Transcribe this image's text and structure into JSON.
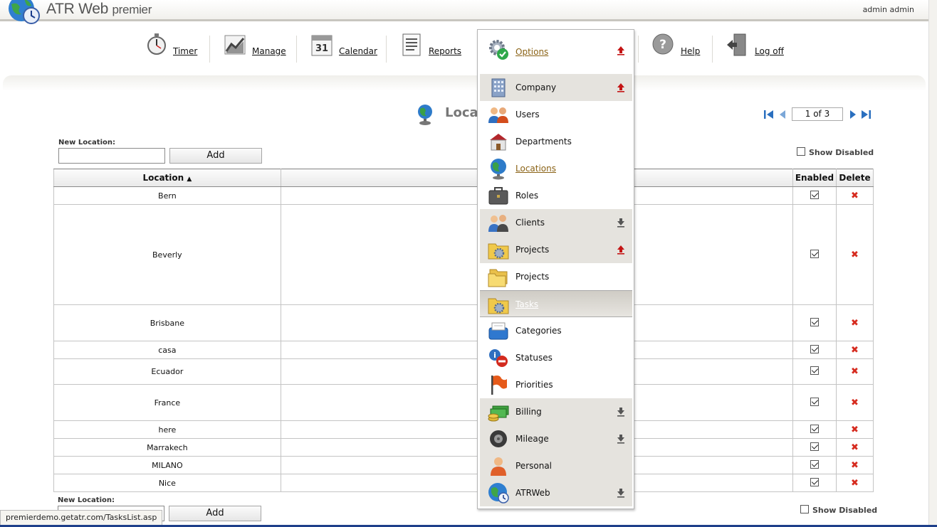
{
  "header": {
    "app_title": "ATR Web",
    "app_title_suffix": "premier",
    "user": "admin admin"
  },
  "nav": [
    {
      "label": "Timer",
      "icon": "stopwatch-icon"
    },
    {
      "label": "Manage",
      "icon": "chart-icon"
    },
    {
      "label": "Calendar",
      "icon": "calendar-icon"
    },
    {
      "label": "Reports",
      "icon": "report-icon"
    },
    {
      "label": "Help",
      "icon": "help-icon"
    },
    {
      "label": "Log off",
      "icon": "logoff-icon"
    }
  ],
  "page": {
    "title": "Loca",
    "pager_text": "1 of 3",
    "new_location_label": "New Location:",
    "add_label": "Add",
    "show_disabled_label": "Show Disabled"
  },
  "table": {
    "headers": {
      "location": "Location",
      "enabled": "Enabled",
      "delete": "Delete"
    },
    "rows": [
      {
        "location": "Bern",
        "enabled": true
      },
      {
        "location": "Beverly",
        "enabled": true
      },
      {
        "location": "Brisbane",
        "enabled": true
      },
      {
        "location": "casa",
        "enabled": true
      },
      {
        "location": "Ecuador",
        "enabled": true
      },
      {
        "location": "France",
        "enabled": true
      },
      {
        "location": "here",
        "enabled": true
      },
      {
        "location": "Marrakech",
        "enabled": true
      },
      {
        "location": "MILANO",
        "enabled": true
      },
      {
        "location": "Nice",
        "enabled": true
      }
    ]
  },
  "menu": {
    "items": [
      {
        "label": "Options",
        "icon": "gear-check-icon",
        "arrow": "up",
        "style": "link"
      },
      {
        "label": "Company",
        "icon": "building-icon",
        "arrow": "up"
      },
      {
        "label": "Users",
        "icon": "users-icon"
      },
      {
        "label": "Departments",
        "icon": "departments-icon"
      },
      {
        "label": "Locations",
        "icon": "globe-icon",
        "style": "link"
      },
      {
        "label": "Roles",
        "icon": "briefcase-icon"
      },
      {
        "label": "Clients",
        "icon": "clients-icon",
        "arrow": "down"
      },
      {
        "label": "Projects",
        "icon": "folder-gear-icon",
        "arrow": "up"
      },
      {
        "label": "Projects",
        "icon": "folder-icon"
      },
      {
        "label": "Tasks",
        "icon": "folder-gear-icon"
      },
      {
        "label": "Categories",
        "icon": "categories-icon"
      },
      {
        "label": "Statuses",
        "icon": "statuses-icon"
      },
      {
        "label": "Priorities",
        "icon": "flag-icon"
      },
      {
        "label": "Billing",
        "icon": "money-icon",
        "arrow": "down"
      },
      {
        "label": "Mileage",
        "icon": "tire-icon",
        "arrow": "down"
      },
      {
        "label": "Personal",
        "icon": "person-icon"
      },
      {
        "label": "ATRWeb",
        "icon": "globe-clock-icon",
        "arrow": "down"
      }
    ]
  },
  "status_bar": {
    "url": "premierdemo.getatr.com/TasksList.asp"
  },
  "colors": {
    "accent_link": "#8a6215",
    "delete_red": "#d62b1f",
    "header_bar": "#c8c6bf"
  }
}
